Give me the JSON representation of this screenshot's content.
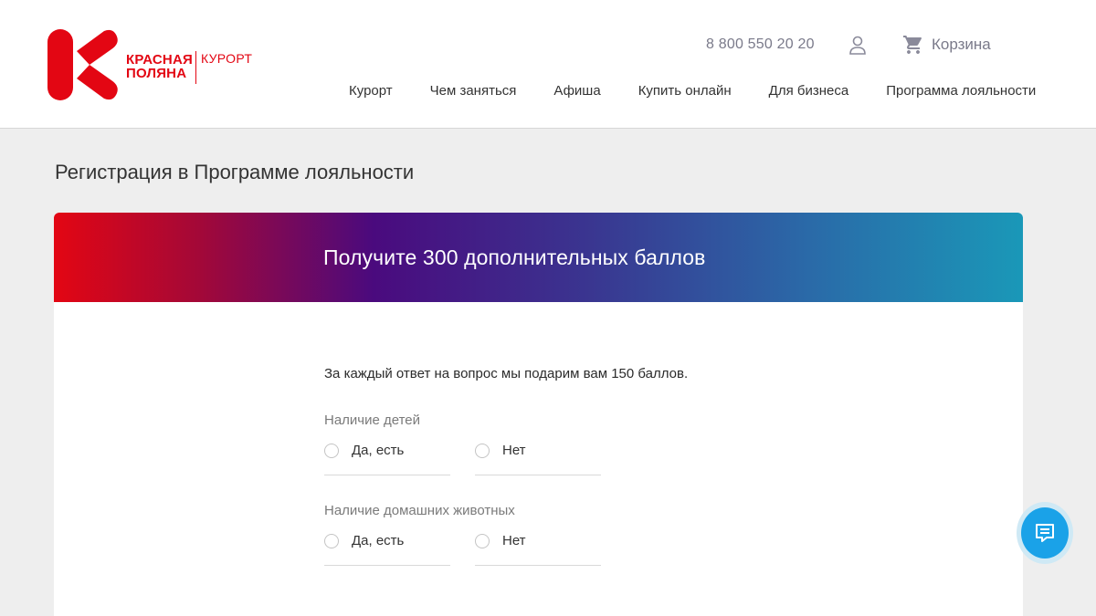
{
  "brand": {
    "logo_line1": "КРАСНАЯ",
    "logo_line2": "ПОЛЯНА",
    "logo_suffix": "КУРОРТ",
    "brand_color": "#e30613"
  },
  "header": {
    "phone": "8 800 550 20 20",
    "user_icon": "user-icon",
    "cart_icon": "cart-icon",
    "cart_label": "Корзина"
  },
  "nav": {
    "items": [
      {
        "label": "Курорт"
      },
      {
        "label": "Чем заняться"
      },
      {
        "label": "Афиша"
      },
      {
        "label": "Купить онлайн"
      },
      {
        "label": "Для бизнеса"
      },
      {
        "label": "Программа лояльности"
      }
    ]
  },
  "page": {
    "title": "Регистрация в Программе лояльности"
  },
  "banner": {
    "text": "Получите 300 дополнительных баллов",
    "gradient_colors": [
      "#e30613",
      "#4a0a7e",
      "#1a98b8"
    ]
  },
  "form": {
    "intro": "За каждый ответ на вопрос мы подарим вам 150 баллов.",
    "questions": [
      {
        "label": "Наличие детей",
        "options": [
          {
            "label": "Да, есть"
          },
          {
            "label": "Нет"
          }
        ]
      },
      {
        "label": "Наличие домашних животных",
        "options": [
          {
            "label": "Да, есть"
          },
          {
            "label": "Нет"
          }
        ]
      }
    ]
  },
  "chat": {
    "icon": "chat-icon",
    "color": "#1aa2e8"
  }
}
